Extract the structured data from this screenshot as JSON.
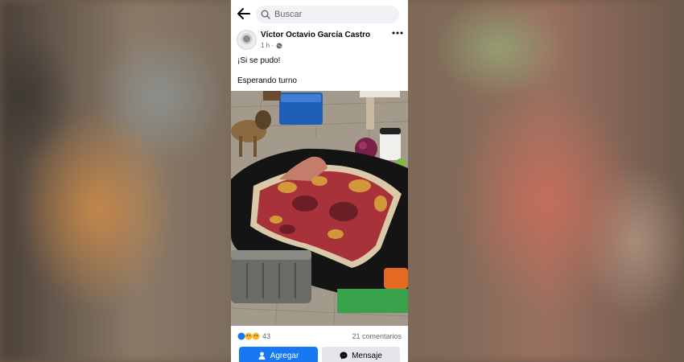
{
  "search": {
    "placeholder": "Buscar"
  },
  "post": {
    "author": "Víctor Octavio García Castro",
    "time": "1 h ·",
    "text_line1": "¡Si se pudo!",
    "text_line2": "Esperando turno"
  },
  "reactions": {
    "count": "43",
    "comments": "21 comentarios"
  },
  "actions": {
    "add_label": "Agregar",
    "message_label": "Mensaje"
  },
  "colors": {
    "accent": "#1877f2",
    "secondary_button": "#e4e6eb"
  },
  "icons": [
    "back-arrow-icon",
    "search-icon",
    "globe-icon",
    "more-options-icon",
    "add-friend-icon",
    "messenger-icon"
  ]
}
